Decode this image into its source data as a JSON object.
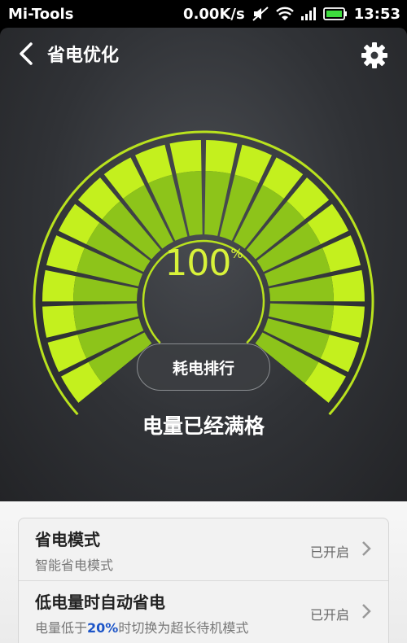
{
  "status_bar": {
    "carrier": "Mi-Tools",
    "net_speed": "0.00K/s",
    "time": "13:53",
    "icons": [
      "mute-icon",
      "wifi-icon",
      "signal-icon",
      "battery-icon"
    ]
  },
  "header": {
    "title": "省电优化",
    "back_icon": "back-chevron-icon",
    "settings_icon": "gear-icon"
  },
  "gauge": {
    "value": "100",
    "unit": "%",
    "fill_fraction": 1.0,
    "colors": {
      "bright": "#c4f01e",
      "dim": "#8dc41a",
      "ring": "#b9e21e"
    }
  },
  "rank_button": {
    "label": "耗电排行"
  },
  "status_text": "电量已经满格",
  "settings_list": [
    {
      "title": "省电模式",
      "subtitle": "智能省电模式",
      "state": "已开启"
    },
    {
      "title": "低电量时自动省电",
      "subtitle_prefix": "电量低于",
      "subtitle_highlight": "20%",
      "subtitle_suffix": "时切换为超长待机模式",
      "state": "已开启"
    }
  ]
}
